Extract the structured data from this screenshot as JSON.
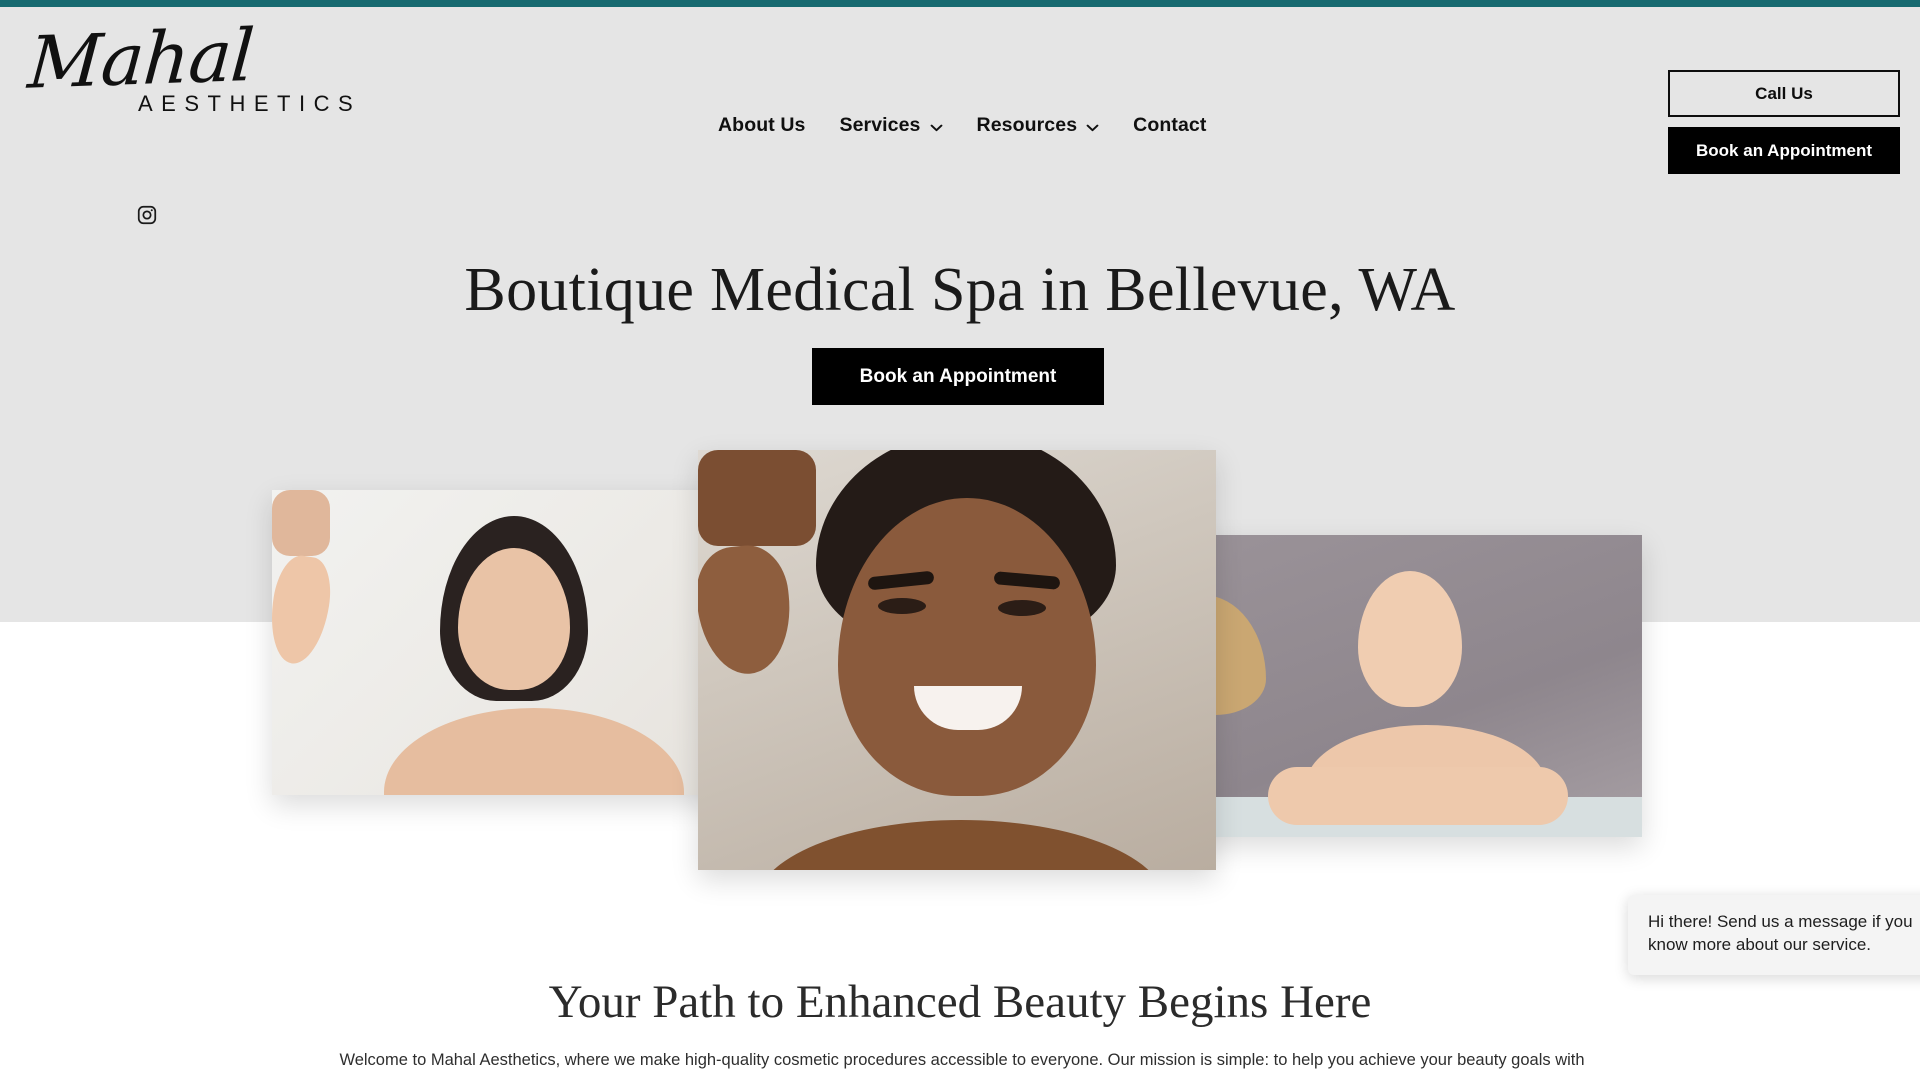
{
  "theme": {
    "accent_bar_color": "#176a70",
    "hero_bg_color": "#e5e5e5",
    "page_bg_color": "#ffffff",
    "button_fill_color": "#000000",
    "button_text_color": "#ffffff",
    "text_color": "#1a1a1a"
  },
  "header": {
    "logo": {
      "script_text": "Mahal",
      "subtitle_text": "AESTHETICS"
    },
    "social": [
      {
        "icon": "instagram-icon",
        "label": "Instagram"
      }
    ],
    "nav": [
      {
        "label": "About Us",
        "has_dropdown": false
      },
      {
        "label": "Services",
        "has_dropdown": true
      },
      {
        "label": "Resources",
        "has_dropdown": true
      },
      {
        "label": "Contact",
        "has_dropdown": false
      }
    ],
    "cta_outline_label": "Call Us",
    "cta_solid_label": "Book an Appointment"
  },
  "hero": {
    "title": "Boutique Medical Spa in Bellevue, WA",
    "cta_label": "Book an Appointment",
    "photos": [
      {
        "alt": "woman with hand on cheek looking aside",
        "position": "left"
      },
      {
        "alt": "smiling man touching his neck",
        "position": "center"
      },
      {
        "alt": "blonde woman resting head on hand",
        "position": "right"
      }
    ]
  },
  "intro_section": {
    "heading": "Your Path to Enhanced Beauty Begins Here",
    "body": "Welcome to Mahal Aesthetics, where we make high-quality cosmetic procedures accessible to everyone. Our mission is simple: to help you achieve your beauty goals with"
  },
  "chat_widget": {
    "message": "Hi there! Send us a message if you know more about our service."
  }
}
